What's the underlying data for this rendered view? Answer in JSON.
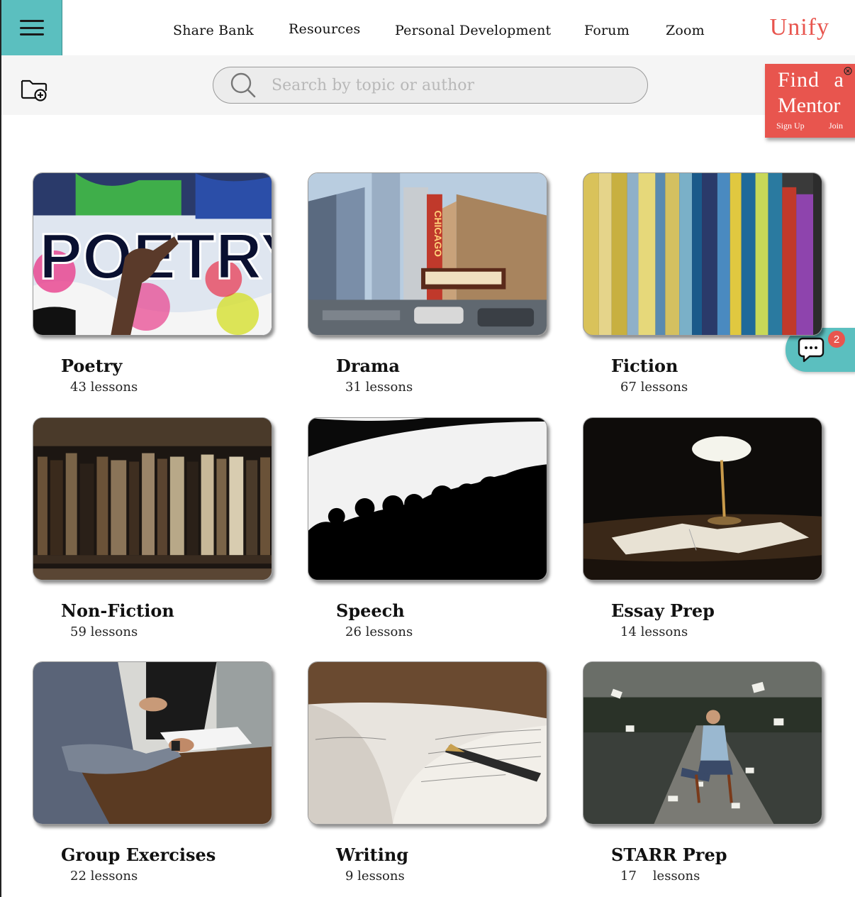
{
  "nav": {
    "menu_icon": "hamburger-icon",
    "links": [
      "Share Bank",
      "Resources",
      "Personal Development",
      "Forum",
      "Zoom"
    ],
    "brand": "Unify"
  },
  "toolbar": {
    "folder_icon": "folder-add-icon",
    "search_icon": "search-icon",
    "search_placeholder": "Search by topic or author"
  },
  "mentor": {
    "line1": "Find a",
    "line2": "Mentor",
    "signup": "Sign Up",
    "join": "Join",
    "close_icon": "close-icon",
    "color": "#e8554e"
  },
  "chat": {
    "icon": "chat-icon",
    "badge": "2",
    "color": "#5bbfbf"
  },
  "categories": [
    {
      "title": "Poetry",
      "count": "43 lessons",
      "image": "graffiti-poetry-wall"
    },
    {
      "title": "Drama",
      "count": "31 lessons",
      "image": "chicago-theatre-street"
    },
    {
      "title": "Fiction",
      "count": "67 lessons",
      "image": "bookshelf-spines"
    },
    {
      "title": "Non-Fiction",
      "count": "59 lessons",
      "image": "antique-library-books"
    },
    {
      "title": "Speech",
      "count": "26 lessons",
      "image": "audience-silhouette"
    },
    {
      "title": "Essay Prep",
      "count": "14 lessons",
      "image": "desk-lamp-open-book"
    },
    {
      "title": "Group Exercises",
      "count": "22 lessons",
      "image": "people-writing-at-table"
    },
    {
      "title": "Writing",
      "count": "9 lessons",
      "image": "fountain-pen-notebook"
    },
    {
      "title": "STARR Prep",
      "count": "17    lessons",
      "image": "man-in-chair-flying-papers"
    }
  ]
}
